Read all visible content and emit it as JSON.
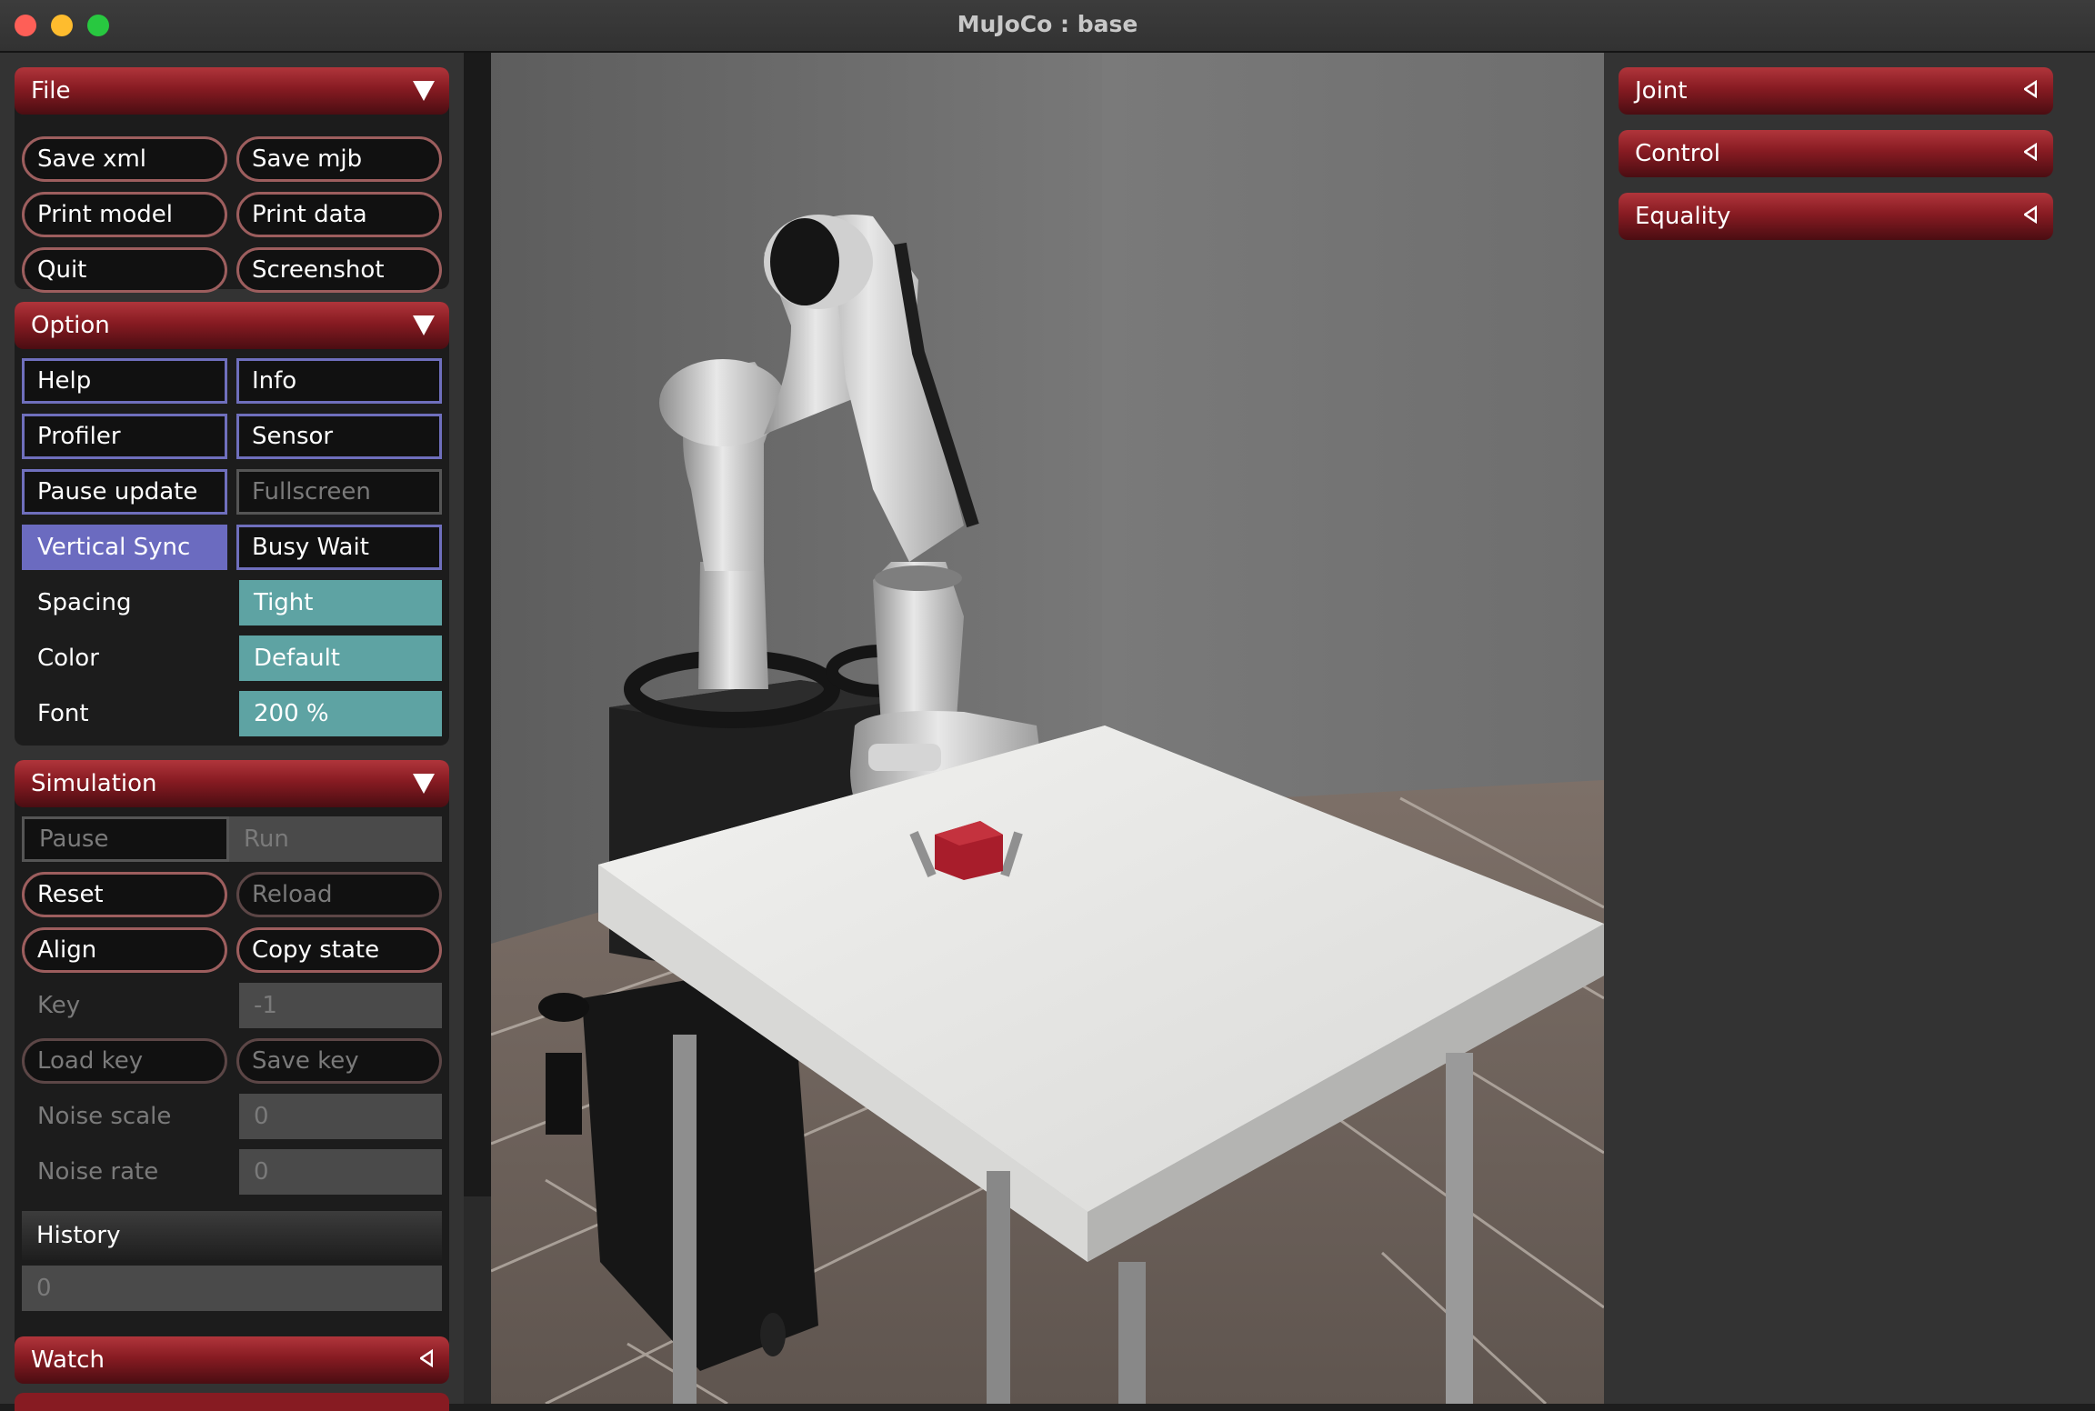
{
  "window": {
    "title": "MuJoCo : base"
  },
  "file": {
    "header": "File",
    "buttons": [
      "Save xml",
      "Save mjb",
      "Print model",
      "Print data",
      "Quit",
      "Screenshot"
    ]
  },
  "option": {
    "header": "Option",
    "toggles": [
      "Help",
      "Info",
      "Profiler",
      "Sensor",
      "Pause update",
      "Fullscreen",
      "Vertical Sync",
      "Busy Wait"
    ],
    "spacing_label": "Spacing",
    "spacing_value": "Tight",
    "color_label": "Color",
    "color_value": "Default",
    "font_label": "Font",
    "font_value": "200 %"
  },
  "simulation": {
    "header": "Simulation",
    "pause": "Pause",
    "run": "Run",
    "reset": "Reset",
    "reload": "Reload",
    "align": "Align",
    "copy_state": "Copy state",
    "key_label": "Key",
    "key_value": "-1",
    "load_key": "Load key",
    "save_key": "Save key",
    "noise_scale_label": "Noise scale",
    "noise_scale_value": "0",
    "noise_rate_label": "Noise rate",
    "noise_rate_value": "0",
    "history_label": "History",
    "history_value": "0"
  },
  "watch": {
    "header": "Watch"
  },
  "right": {
    "sections": [
      "Joint",
      "Control",
      "Equality"
    ]
  },
  "colors": {
    "header_red": "#871b22",
    "pill_border": "#9d5e5e",
    "toggle_border": "#6f6fbd",
    "toggle_on": "#6b6bc0",
    "select_teal": "#5ea3a3",
    "panel_bg": "#333333",
    "section_bg": "#1c1c1c"
  },
  "icons": [
    "close-icon",
    "minimize-icon",
    "maximize-icon",
    "triangle-down-icon",
    "triangle-left-icon"
  ]
}
